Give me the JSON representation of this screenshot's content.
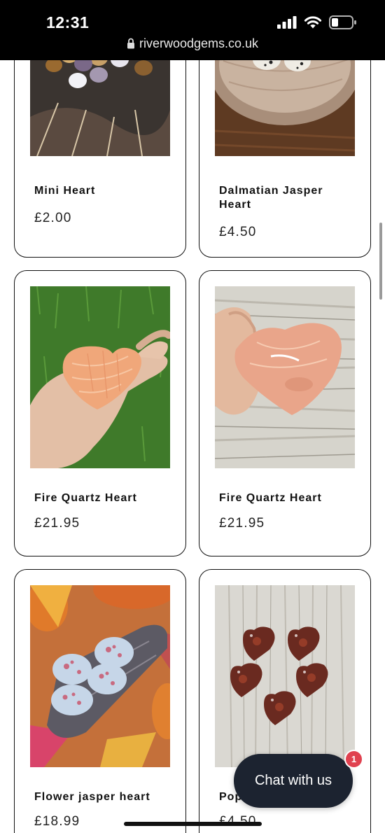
{
  "status_bar": {
    "time": "12:31",
    "url": "riverwoodgems.co.uk",
    "icons": [
      "cellular-signal-icon",
      "wifi-icon",
      "battery-icon"
    ]
  },
  "products": [
    {
      "title": "Mini Heart",
      "price": "£2.00",
      "image": "mini-hearts-photo"
    },
    {
      "title": "Dalmatian Jasper Heart",
      "price": "£4.50",
      "image": "dalmatian-jasper-photo"
    },
    {
      "title": "Fire Quartz Heart",
      "price": "£21.95",
      "image": "fire-quartz-hand-photo"
    },
    {
      "title": "Fire Quartz Heart",
      "price": "£21.95",
      "image": "fire-quartz-wood-photo"
    },
    {
      "title": "Flower jasper heart",
      "price": "£18.99",
      "image": "flower-jasper-photo"
    },
    {
      "title": "Pop",
      "price": "£4.50",
      "image": "poppy-jasper-photo"
    }
  ],
  "chat": {
    "label": "Chat with us",
    "badge": "1"
  },
  "colors": {
    "status_bg": "#000000",
    "chat_bg": "#1c2330",
    "badge": "#e0414f",
    "card_border": "#111111"
  }
}
